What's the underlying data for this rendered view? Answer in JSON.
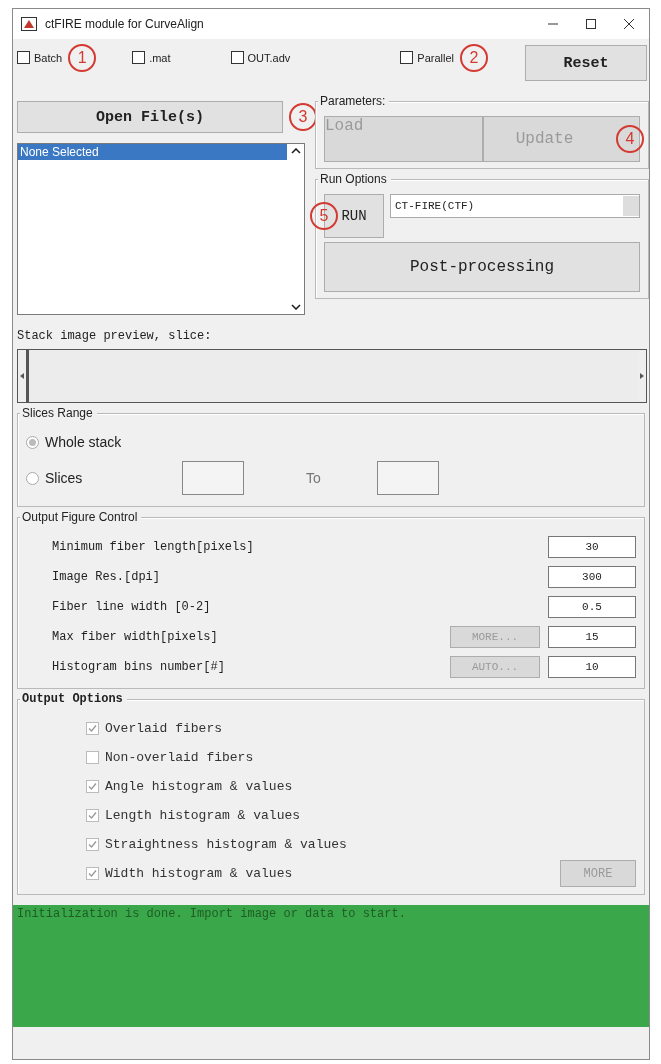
{
  "window": {
    "title": "ctFIRE module for CurveAlign"
  },
  "top_options": [
    {
      "label": "Batch",
      "checked": false,
      "callout": "1"
    },
    {
      "label": ".mat",
      "checked": false
    },
    {
      "label": "OUT.adv",
      "checked": false
    },
    {
      "label": "Parallel",
      "checked": false,
      "callout": "2"
    }
  ],
  "reset_button": {
    "label": "Reset"
  },
  "open_button": {
    "label": "Open File(s)",
    "callout": "3"
  },
  "file_list": {
    "items": [
      {
        "label": "None Selected",
        "selected": true
      }
    ]
  },
  "parameters": {
    "title": "Parameters:",
    "buttons": [
      {
        "label": "Load",
        "disabled": true
      },
      {
        "label": "Update",
        "disabled": true,
        "callout": "4"
      }
    ]
  },
  "run_options": {
    "title": "Run Options",
    "run_button": {
      "label": "RUN",
      "callout": "5"
    },
    "mode_select": {
      "value": "CT-FIRE(CTF)"
    },
    "postprocess_button": {
      "label": "Post-processing"
    }
  },
  "stack_preview": {
    "label": "Stack image preview, slice:",
    "level": 0
  },
  "slices_range": {
    "title": "Slices Range",
    "options": [
      {
        "label": "Whole stack",
        "selected": true
      },
      {
        "label": "Slices",
        "selected": false
      }
    ],
    "to_label": "To"
  },
  "output_figure_control": {
    "title": "Output Figure Control",
    "rows": [
      {
        "label": "Minimum fiber length[pixels]",
        "value": "30"
      },
      {
        "label": "Image Res.[dpi]",
        "value": "300"
      },
      {
        "label": "Fiber line width [0-2]",
        "value": "0.5"
      },
      {
        "label": "Max fiber width[pixels]",
        "button": {
          "label": "MORE...",
          "disabled": true
        },
        "value": "15"
      },
      {
        "label": "Histogram bins number[#]",
        "button": {
          "label": "AUTO...",
          "disabled": true
        },
        "value": "10"
      }
    ]
  },
  "output_options": {
    "title": "Output Options",
    "items": [
      {
        "label": "Overlaid fibers",
        "checked": true
      },
      {
        "label": "Non-overlaid fibers",
        "checked": false
      },
      {
        "label": "Angle histogram & values",
        "checked": true
      },
      {
        "label": "Length histogram & values",
        "checked": true
      },
      {
        "label": "Straightness histogram & values",
        "checked": true
      },
      {
        "label": "Width histogram & values",
        "checked": true
      }
    ],
    "more_button": {
      "label": "MORE",
      "disabled": true
    }
  },
  "status": {
    "message": "Initialization is done. Import image or data to start."
  }
}
